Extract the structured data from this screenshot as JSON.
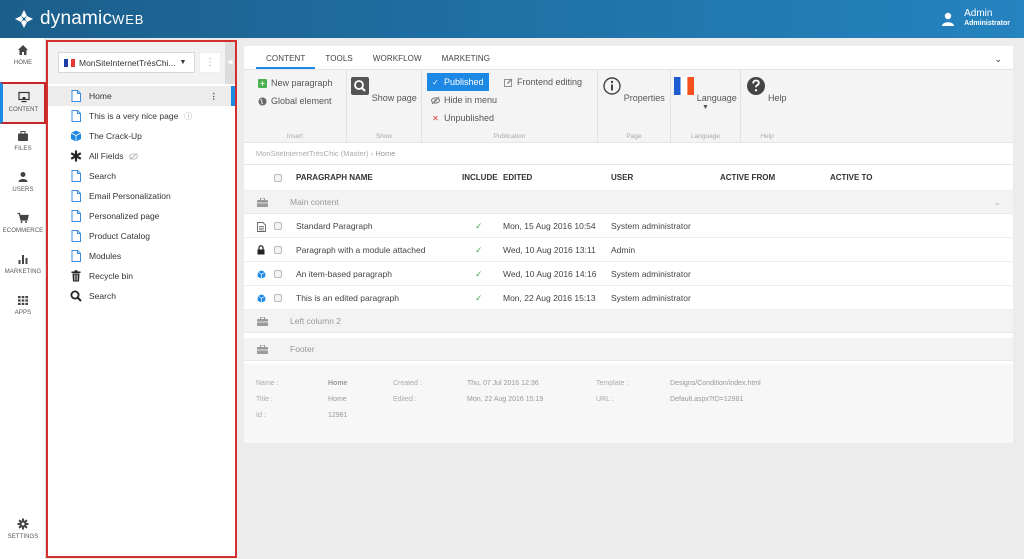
{
  "header": {
    "brand_main": "dynamic",
    "brand_suffix": "WEB",
    "user_name": "Admin",
    "user_role": "Administrator",
    "icons": {
      "logo": "dynamicweb-logo-icon",
      "user": "user-icon"
    }
  },
  "leftnav": {
    "items": [
      {
        "label": "HOME",
        "icon": "home-icon"
      },
      {
        "label": "CONTENT",
        "icon": "monitor-icon",
        "active": true
      },
      {
        "label": "FILES",
        "icon": "briefcase-icon"
      },
      {
        "label": "USERS",
        "icon": "user-icon"
      },
      {
        "label": "ECOMMERCE",
        "icon": "cart-icon"
      },
      {
        "label": "MARKETING",
        "icon": "bar-chart-icon"
      },
      {
        "label": "APPS",
        "icon": "apps-grid-icon"
      }
    ],
    "settings_label": "SETTINGS"
  },
  "tree": {
    "site_select": "MonSiteInternetTrésChi...",
    "more_label": "⋮",
    "items": [
      {
        "label": "Home",
        "icon": "page-icon",
        "selected": true
      },
      {
        "label": "This is a very nice page",
        "icon": "page-icon",
        "extra": "ⓘ"
      },
      {
        "label": "The Crack-Up",
        "icon": "cube-icon"
      },
      {
        "label": "All Fields",
        "icon": "asterisk-icon",
        "extra": "hidden-eye"
      },
      {
        "label": "Search",
        "icon": "page-icon"
      },
      {
        "label": "Email Personalization",
        "icon": "page-icon"
      },
      {
        "label": "Personalized page",
        "icon": "page-icon"
      },
      {
        "label": "Product Catalog",
        "icon": "page-icon"
      },
      {
        "label": "Modules",
        "icon": "page-icon"
      },
      {
        "label": "Recycle bin",
        "icon": "trash-icon"
      },
      {
        "label": "Search",
        "icon": "search-icon"
      }
    ]
  },
  "tabs": [
    "CONTENT",
    "TOOLS",
    "WORKFLOW",
    "MARKETING"
  ],
  "ribbon": {
    "insert": {
      "new_paragraph": "New paragraph",
      "global_element": "Global element",
      "label": "Insert"
    },
    "show": {
      "show_page": "Show page",
      "label": "Show"
    },
    "publication": {
      "published": "Published",
      "hide_in_menu": "Hide in menu",
      "unpublished": "Unpublished",
      "frontend_editing": "Frontend editing",
      "label": "Publication"
    },
    "page": {
      "properties": "Properties",
      "label": "Page"
    },
    "language": {
      "language": "Language",
      "label": "Language"
    },
    "help": {
      "help": "Help",
      "label": "Help"
    }
  },
  "breadcrumb": {
    "site": "MonSiteInternetTrésChic (Master)",
    "sep": "›",
    "page": "Home"
  },
  "grid": {
    "columns": {
      "name": "PARAGRAPH NAME",
      "include": "INCLUDE",
      "edited": "EDITED",
      "user": "USER",
      "active_from": "ACTIVE FROM",
      "active_to": "ACTIVE TO"
    },
    "sections": [
      {
        "name": "Main content"
      },
      {
        "name": "Left column 2"
      },
      {
        "name": "Footer"
      }
    ],
    "rows": [
      {
        "name": "Standard Paragraph",
        "icon": "document-icon",
        "include": "✓",
        "edited": "Mon, 15 Aug 2016 10:54",
        "user": "System administrator"
      },
      {
        "name": "Paragraph with a module attached",
        "icon": "lock-icon",
        "include": "✓",
        "edited": "Wed, 10 Aug 2016 13:11",
        "user": "Admin"
      },
      {
        "name": "An item-based paragraph",
        "icon": "cube-icon",
        "include": "✓",
        "edited": "Wed, 10 Aug 2016 14:16",
        "user": "System administrator"
      },
      {
        "name": "This is an edited paragraph",
        "icon": "cube-icon",
        "include": "✓",
        "edited": "Mon, 22 Aug 2016 15:13",
        "user": "System administrator"
      }
    ]
  },
  "info": {
    "name_label": "Name :",
    "name": "Home",
    "title_label": "Title :",
    "title": "Home",
    "id_label": "Id :",
    "id": "12981",
    "created_label": "Created :",
    "created": "Thu, 07 Jul 2016 12:36",
    "edited_label": "Edited :",
    "edited": "Mon, 22 Aug 2016 15:19",
    "template_label": "Template :",
    "template": "Designs/Condition/index.html",
    "url_label": "URL :",
    "url": "Default.aspx?ID=12981"
  },
  "colors": {
    "accent": "#1e88e5",
    "header": "#1f6fa3",
    "highlight_border": "#d32f2f",
    "include_check": "#4caf50"
  }
}
